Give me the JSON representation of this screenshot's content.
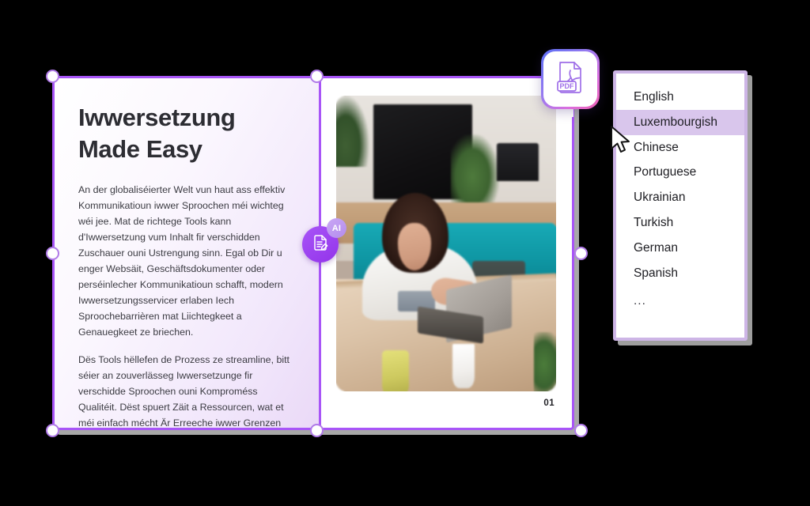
{
  "slide": {
    "title": "Iwwersetzung\nMade Easy",
    "paragraphs": [
      "An der globaliséierter Welt vun haut ass effektiv Kommunikatioun iwwer Sproochen méi wichteg wéi jee. Mat de richtege Tools kann d'Iwwersetzung vum Inhalt fir verschidden Zuschauer ouni Ustrengung sinn. Egal ob Dir u enger Websäit, Geschäftsdokumenter oder perséinlecher Kommunikatioun schafft, modern Iwwersetzungsservicer erlaben Iech Sproochebarrièren mat Liichtegkeet a Genauegkeet ze briechen.",
      "Dës Tools hëllefen de Prozess ze streamline, bitt séier an zouverlässeg Iwwersetzunge fir verschidde Sproochen ouni Komproméss Qualitéit. Dëst spuert Zäit a Ressourcen, wat et méi einfach mécht Är Erreeche iwwer Grenzen auszebauen."
    ],
    "page_number": "01",
    "photo_alt": "woman with curly hair working on laptop at wooden table"
  },
  "badges": {
    "pdf_label": "PDF",
    "pdf_icon": "pdf-file-icon",
    "ai_label": "AI",
    "ai_icon": "document-edit-icon"
  },
  "language_dropdown": {
    "items": [
      {
        "label": "English",
        "selected": false
      },
      {
        "label": "Luxembourgish",
        "selected": true
      },
      {
        "label": "Chinese",
        "selected": false
      },
      {
        "label": "Portuguese",
        "selected": false
      },
      {
        "label": "Ukrainian",
        "selected": false
      },
      {
        "label": "Turkish",
        "selected": false
      },
      {
        "label": "German",
        "selected": false
      },
      {
        "label": "Spanish",
        "selected": false
      }
    ],
    "overflow_label": "..."
  },
  "colors": {
    "accent_purple": "#a855f7",
    "selection_handle_border": "#b07ae8",
    "dropdown_border": "#cdb5e6",
    "dropdown_selected_bg": "#d9c6ec",
    "slide_gradient_end": "#ead9f7",
    "sofa_teal": "#0e94a1",
    "canvas_background": "#000000"
  }
}
